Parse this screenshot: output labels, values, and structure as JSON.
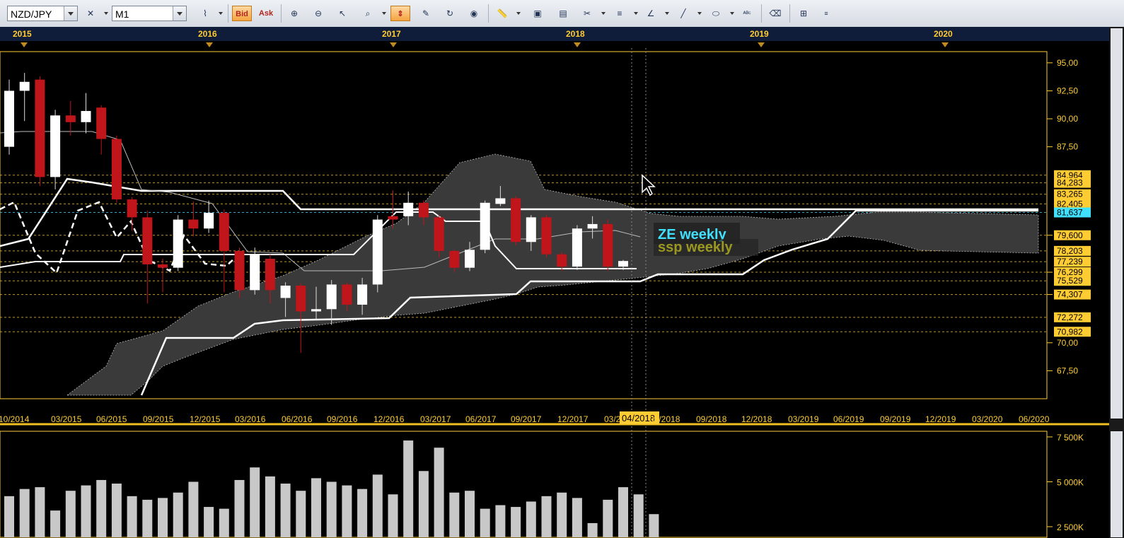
{
  "toolbar": {
    "symbol": "NZD/JPY",
    "timeframe": "M1",
    "bid_label": "Bid",
    "ask_label": "Ask"
  },
  "years": [
    "2015",
    "2016",
    "2017",
    "2018",
    "2019",
    "2020"
  ],
  "price_ticks": [
    "95,00",
    "92,50",
    "90,00",
    "87,50",
    "79,600",
    "76,299",
    "74,307",
    "70,00",
    "67,50"
  ],
  "level_badges": [
    {
      "text": "84,964",
      "color": "#ffcc33"
    },
    {
      "text": "84,283",
      "color": "#ffcc33"
    },
    {
      "text": "83,265",
      "color": "#ffcc33"
    },
    {
      "text": "82,405",
      "color": "#ffcc33"
    },
    {
      "text": "81,637",
      "color": "#40e0ff"
    },
    {
      "text": "79,600",
      "color": "#ffcc33"
    },
    {
      "text": "78,203",
      "color": "#ffcc33"
    },
    {
      "text": "77,239",
      "color": "#ffcc33"
    },
    {
      "text": "76,299",
      "color": "#ffcc33"
    },
    {
      "text": "75,529",
      "color": "#ffcc33"
    },
    {
      "text": "74,307",
      "color": "#ffcc33"
    },
    {
      "text": "72,272",
      "color": "#ffcc33"
    },
    {
      "text": "70,982",
      "color": "#ffcc33"
    }
  ],
  "date_ticks": [
    "10/2014",
    "03/2015",
    "06/2015",
    "09/2015",
    "12/2015",
    "03/2016",
    "06/2016",
    "09/2016",
    "12/2016",
    "03/2017",
    "06/2017",
    "09/2017",
    "12/2017",
    "03/2018",
    "04/2018",
    "06/2018",
    "09/2018",
    "12/2018",
    "03/2019",
    "06/2019",
    "09/2019",
    "12/2019",
    "03/2020",
    "06/2020"
  ],
  "cursor_date": "04/2018",
  "volume_ticks": [
    "7 500K",
    "5 000K",
    "2 500K"
  ],
  "annotations": {
    "ze_label": "ZE weekly",
    "ssp_label": "ssp weekly"
  },
  "colors": {
    "bull": "#ffffff",
    "bear": "#c0161b",
    "grid": "#ffcc33",
    "cloud": "#3a3a3a",
    "cyan": "#40e0ff",
    "axis_bg": "#000000"
  },
  "chart_data": {
    "type": "candlestick",
    "symbol": "NZD/JPY",
    "timeframe": "M1",
    "ylim": [
      65.0,
      96.0
    ],
    "candles": [
      {
        "o": 87.5,
        "c": 92.5,
        "h": 93.5,
        "l": 86.8,
        "d": "bull"
      },
      {
        "o": 92.5,
        "c": 93.3,
        "h": 94.1,
        "l": 89.8,
        "d": "bull"
      },
      {
        "o": 93.5,
        "c": 84.8,
        "h": 93.8,
        "l": 84.0,
        "d": "bear"
      },
      {
        "o": 84.8,
        "c": 90.3,
        "h": 90.8,
        "l": 83.7,
        "d": "bull"
      },
      {
        "o": 90.3,
        "c": 89.7,
        "h": 91.6,
        "l": 88.5,
        "d": "bear"
      },
      {
        "o": 89.7,
        "c": 90.7,
        "h": 92.3,
        "l": 88.7,
        "d": "bull"
      },
      {
        "o": 91.0,
        "c": 88.2,
        "h": 91.2,
        "l": 86.8,
        "d": "bear"
      },
      {
        "o": 88.2,
        "c": 82.8,
        "h": 88.5,
        "l": 82.5,
        "d": "bear"
      },
      {
        "o": 82.8,
        "c": 81.2,
        "h": 83.0,
        "l": 80.0,
        "d": "bear"
      },
      {
        "o": 81.2,
        "c": 77.0,
        "h": 81.8,
        "l": 73.5,
        "d": "bear"
      },
      {
        "o": 77.0,
        "c": 76.7,
        "h": 77.5,
        "l": 74.5,
        "d": "bear"
      },
      {
        "o": 76.7,
        "c": 81.0,
        "h": 81.4,
        "l": 76.4,
        "d": "bull"
      },
      {
        "o": 81.0,
        "c": 80.2,
        "h": 82.6,
        "l": 79.5,
        "d": "bear"
      },
      {
        "o": 80.2,
        "c": 81.6,
        "h": 82.7,
        "l": 79.8,
        "d": "bull"
      },
      {
        "o": 81.6,
        "c": 78.2,
        "h": 81.9,
        "l": 74.5,
        "d": "bear"
      },
      {
        "o": 78.2,
        "c": 74.7,
        "h": 78.5,
        "l": 74.0,
        "d": "bear"
      },
      {
        "o": 74.7,
        "c": 77.9,
        "h": 78.5,
        "l": 74.3,
        "d": "bull"
      },
      {
        "o": 77.5,
        "c": 74.7,
        "h": 77.9,
        "l": 73.5,
        "d": "bear"
      },
      {
        "o": 74.0,
        "c": 75.1,
        "h": 75.4,
        "l": 72.3,
        "d": "bull"
      },
      {
        "o": 75.1,
        "c": 72.8,
        "h": 75.3,
        "l": 69.1,
        "d": "bear"
      },
      {
        "o": 72.8,
        "c": 73.0,
        "h": 75.0,
        "l": 72.0,
        "d": "bull"
      },
      {
        "o": 73.0,
        "c": 75.2,
        "h": 75.6,
        "l": 71.6,
        "d": "bull"
      },
      {
        "o": 75.2,
        "c": 73.4,
        "h": 75.4,
        "l": 72.8,
        "d": "bear"
      },
      {
        "o": 73.4,
        "c": 75.2,
        "h": 75.8,
        "l": 72.5,
        "d": "bull"
      },
      {
        "o": 75.2,
        "c": 81.0,
        "h": 81.4,
        "l": 74.5,
        "d": "bull"
      },
      {
        "o": 81.0,
        "c": 81.3,
        "h": 83.6,
        "l": 80.2,
        "d": "bear"
      },
      {
        "o": 81.3,
        "c": 82.5,
        "h": 83.5,
        "l": 80.5,
        "d": "bull"
      },
      {
        "o": 82.5,
        "c": 81.2,
        "h": 82.7,
        "l": 80.5,
        "d": "bear"
      },
      {
        "o": 81.2,
        "c": 78.2,
        "h": 81.4,
        "l": 77.6,
        "d": "bear"
      },
      {
        "o": 78.2,
        "c": 76.7,
        "h": 78.3,
        "l": 76.3,
        "d": "bear"
      },
      {
        "o": 76.7,
        "c": 78.3,
        "h": 79.0,
        "l": 76.4,
        "d": "bull"
      },
      {
        "o": 78.3,
        "c": 82.5,
        "h": 82.7,
        "l": 78.0,
        "d": "bull"
      },
      {
        "o": 82.4,
        "c": 82.9,
        "h": 84.0,
        "l": 82.2,
        "d": "bull"
      },
      {
        "o": 82.9,
        "c": 79.0,
        "h": 83.1,
        "l": 78.7,
        "d": "bear"
      },
      {
        "o": 79.0,
        "c": 81.2,
        "h": 81.4,
        "l": 78.2,
        "d": "bull"
      },
      {
        "o": 81.2,
        "c": 77.9,
        "h": 81.4,
        "l": 77.6,
        "d": "bear"
      },
      {
        "o": 77.9,
        "c": 76.8,
        "h": 78.1,
        "l": 76.4,
        "d": "bear"
      },
      {
        "o": 76.8,
        "c": 80.2,
        "h": 80.5,
        "l": 76.5,
        "d": "bull"
      },
      {
        "o": 80.2,
        "c": 80.6,
        "h": 81.3,
        "l": 79.3,
        "d": "bull"
      },
      {
        "o": 80.6,
        "c": 76.8,
        "h": 81.0,
        "l": 76.4,
        "d": "bear"
      },
      {
        "o": 76.8,
        "c": 77.3,
        "h": 77.4,
        "l": 76.5,
        "d": "bull"
      }
    ],
    "volume": [
      4.2,
      4.6,
      4.7,
      3.4,
      4.5,
      4.8,
      5.1,
      4.9,
      4.2,
      4.0,
      4.1,
      4.4,
      5.0,
      3.6,
      3.5,
      5.1,
      5.8,
      5.3,
      4.9,
      4.5,
      5.2,
      5.0,
      4.8,
      4.6,
      5.4,
      4.3,
      7.3,
      5.6,
      6.9,
      4.4,
      4.5,
      3.5,
      3.7,
      3.6,
      3.9,
      4.2,
      4.4,
      4.1,
      2.7,
      4.0,
      4.7,
      4.3,
      3.2
    ],
    "volume_ylim": [
      2.5,
      7.5
    ],
    "volume_unit": "K (thousands)"
  }
}
